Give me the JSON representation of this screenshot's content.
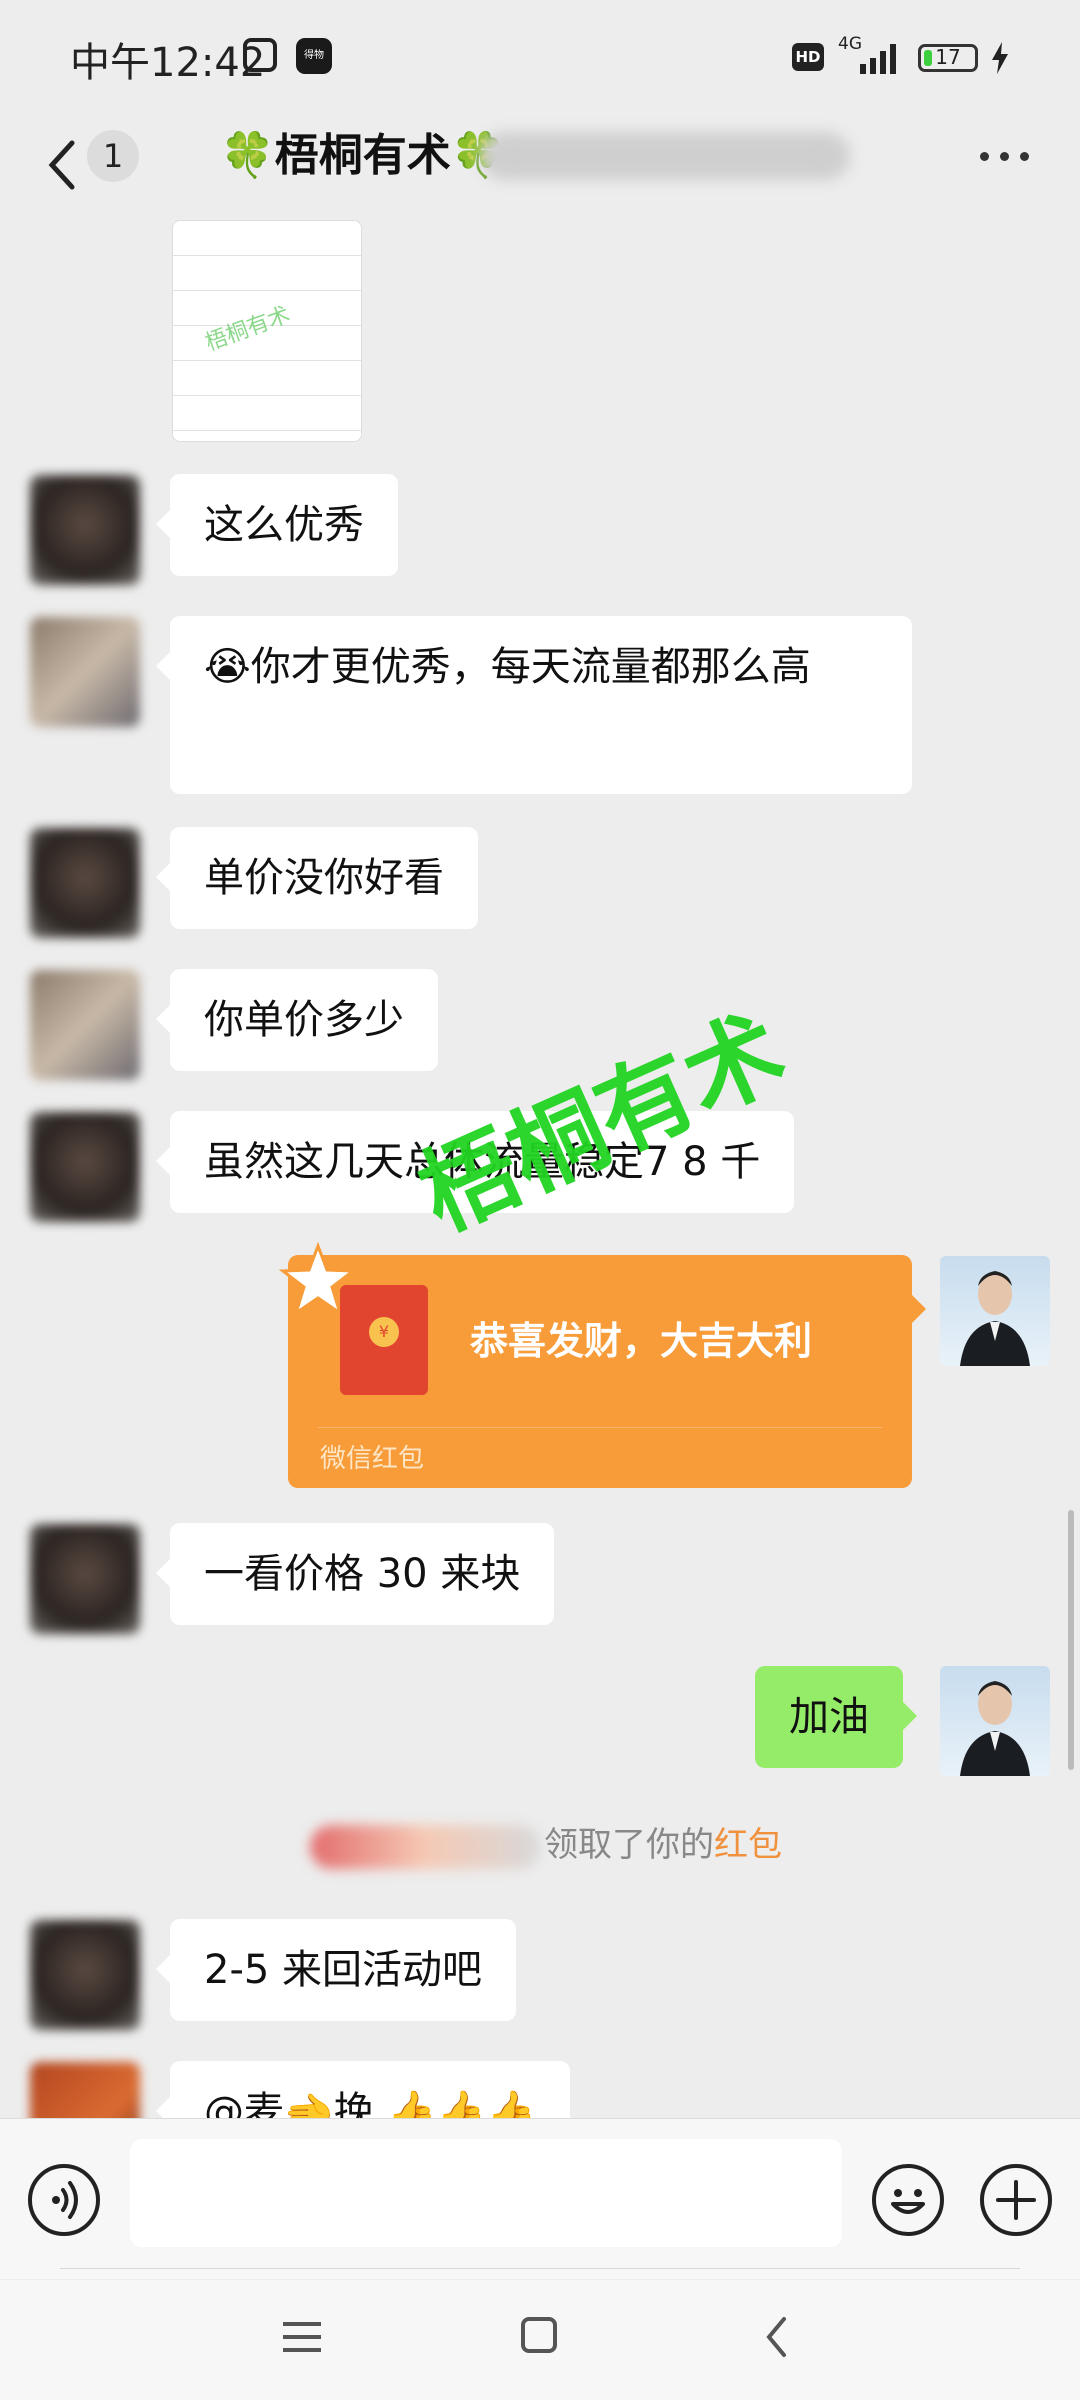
{
  "status_bar": {
    "time": "中午12:42",
    "app_icon_text": "得物",
    "hd": "HD",
    "network": "4G",
    "battery": "17",
    "battery_level": 0.17
  },
  "nav": {
    "unread_count": "1",
    "title": "🍀梧桐有术🍀"
  },
  "watermark": "梧桐有术",
  "image_watermark": "梧桐有术",
  "messages": [
    {
      "side": "left",
      "text": "这么优秀"
    },
    {
      "side": "left",
      "text": "😭你才更优秀，每天流量都那么高"
    },
    {
      "side": "left",
      "text": "单价没你好看"
    },
    {
      "side": "left",
      "text": "你单价多少"
    },
    {
      "side": "left",
      "text": "虽然这几天总体流量稳定7 8 千"
    },
    {
      "side": "right",
      "type": "red_packet",
      "text": "恭喜发财，大吉大利",
      "label": "微信红包"
    },
    {
      "side": "left",
      "text": "一看价格 30 来块"
    },
    {
      "side": "right",
      "text": "加油"
    },
    {
      "side": "left",
      "text": "2-5 来回活动吧"
    },
    {
      "side": "left",
      "text": "@麦🫲挽 👍👍👍"
    }
  ],
  "notice": {
    "prefix": "领取了你的",
    "highlight": "红包",
    "highlight_color": "#f0913d"
  },
  "colors": {
    "background": "#ededed",
    "my_bubble": "#95ec69",
    "red_packet": "#f79c39",
    "watermark": "#21d421"
  }
}
